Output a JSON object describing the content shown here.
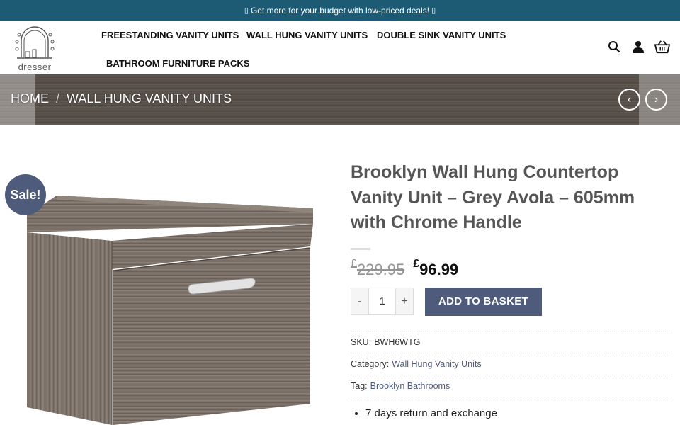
{
  "promo": {
    "text": "Get more for your budget with low-priced deals!",
    "box_glyph": "▯"
  },
  "logo": {
    "text": "dresser"
  },
  "nav": {
    "items": [
      {
        "label": "FREESTANDING VANITY UNITS"
      },
      {
        "label": "WALL HUNG VANITY UNITS"
      },
      {
        "label": "DOUBLE SINK VANITY UNITS"
      },
      {
        "label": "BATHROOM FURNITURE PACKS"
      }
    ]
  },
  "header_icons": [
    "search-icon",
    "user-icon",
    "basket-icon"
  ],
  "breadcrumb": {
    "home": "HOME",
    "separator": "/",
    "current": "WALL HUNG VANITY UNITS"
  },
  "banner_nav": {
    "prev": "‹",
    "next": "›"
  },
  "product": {
    "badge": "Sale!",
    "title": "Brooklyn Wall Hung Countertop Vanity Unit – Grey Avola – 605mm with Chrome Handle",
    "old_price": "229.95",
    "new_price": "96.99",
    "currency": "£",
    "quantity": "1",
    "qty_minus": "-",
    "qty_plus": "+",
    "add_label": "ADD TO BASKET",
    "sku_label": "SKU:",
    "sku": "BWH6WTG",
    "category_label": "Category:",
    "category": "Wall Hung Vanity Units",
    "tag_label": "Tag:",
    "tag": "Brooklyn Bathrooms",
    "features": [
      "7 days return and exchange"
    ]
  },
  "colors": {
    "promo_bg": "#1d5a73",
    "accent": "#4e5b7a"
  }
}
